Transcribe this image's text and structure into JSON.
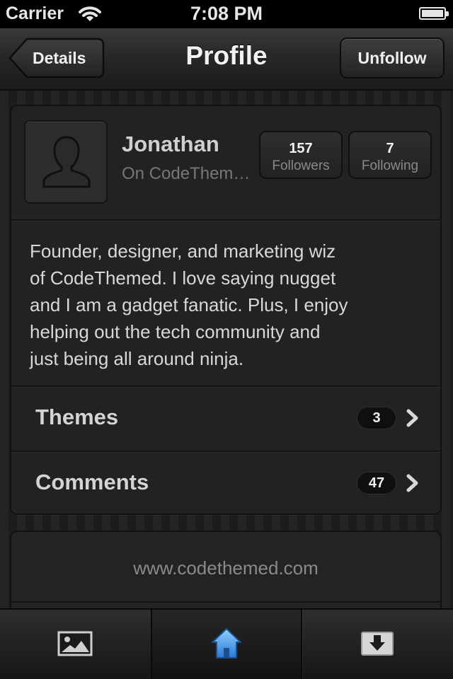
{
  "status_bar": {
    "carrier": "Carrier",
    "time": "7:08 PM",
    "wifi_icon": "wifi-icon",
    "battery_icon": "battery-icon"
  },
  "nav": {
    "back_label": "Details",
    "title": "Profile",
    "action_label": "Unfollow"
  },
  "profile": {
    "avatar_icon": "person-silhouette-icon",
    "name": "Jonathan",
    "subtitle": "On CodeThemed",
    "followers_count": "157",
    "followers_label": "Followers",
    "following_count": "7",
    "following_label": "Following",
    "bio_lines": [
      "Founder, designer, and marketing wiz",
      "of CodeThemed. I love saying nugget",
      "and I am a gadget fanatic. Plus, I enjoy",
      "helping out the tech community and",
      "just being all around ninja."
    ],
    "rows": [
      {
        "label": "Themes",
        "count": "3"
      },
      {
        "label": "Comments",
        "count": "47"
      }
    ]
  },
  "website": {
    "url": "www.codethemed.com"
  },
  "tab_bar": {
    "tabs": [
      {
        "icon": "photo-icon",
        "selected": false
      },
      {
        "icon": "home-icon",
        "selected": true
      },
      {
        "icon": "download-icon",
        "selected": false
      }
    ]
  },
  "colors": {
    "background": "#1f1f1f",
    "card": "#222222",
    "home_icon_blue": "#3a8ee6"
  }
}
